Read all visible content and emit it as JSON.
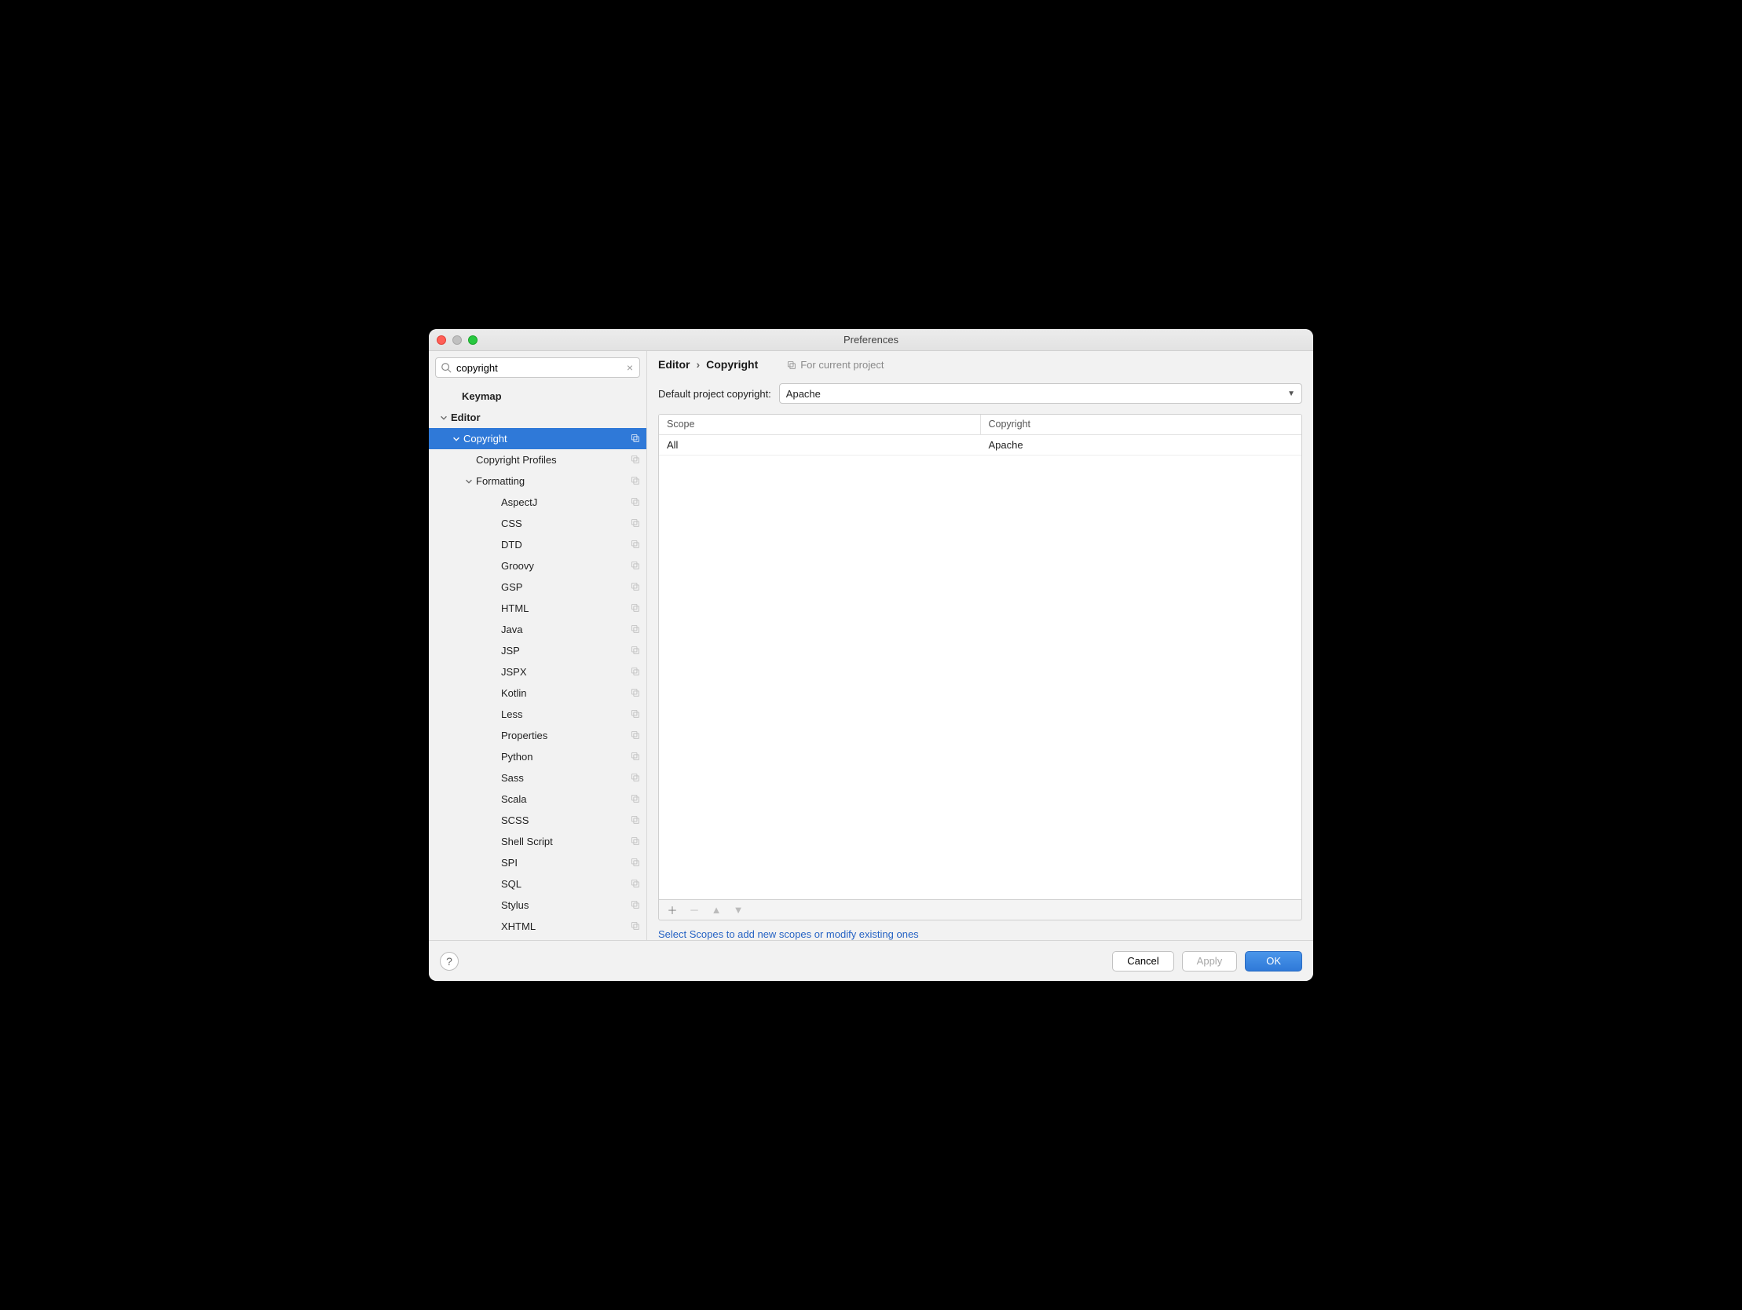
{
  "window": {
    "title": "Preferences"
  },
  "search": {
    "value": "copyright"
  },
  "sidebar": {
    "items": [
      {
        "label": "Keymap",
        "indent": 0,
        "bold": true,
        "arrow": "",
        "badge": false,
        "selected": false
      },
      {
        "label": "Editor",
        "indent": 1,
        "bold": true,
        "arrow": "down",
        "badge": false,
        "selected": false
      },
      {
        "label": "Copyright",
        "indent": 2,
        "bold": false,
        "arrow": "down",
        "badge": true,
        "selected": true
      },
      {
        "label": "Copyright Profiles",
        "indent": 3,
        "bold": false,
        "arrow": "",
        "badge": true,
        "selected": false
      },
      {
        "label": "Formatting",
        "indent": 3,
        "bold": false,
        "arrow": "down",
        "badge": true,
        "selected": false
      },
      {
        "label": "AspectJ",
        "indent": 4,
        "bold": false,
        "arrow": "",
        "badge": true,
        "selected": false
      },
      {
        "label": "CSS",
        "indent": 4,
        "bold": false,
        "arrow": "",
        "badge": true,
        "selected": false
      },
      {
        "label": "DTD",
        "indent": 4,
        "bold": false,
        "arrow": "",
        "badge": true,
        "selected": false
      },
      {
        "label": "Groovy",
        "indent": 4,
        "bold": false,
        "arrow": "",
        "badge": true,
        "selected": false
      },
      {
        "label": "GSP",
        "indent": 4,
        "bold": false,
        "arrow": "",
        "badge": true,
        "selected": false
      },
      {
        "label": "HTML",
        "indent": 4,
        "bold": false,
        "arrow": "",
        "badge": true,
        "selected": false
      },
      {
        "label": "Java",
        "indent": 4,
        "bold": false,
        "arrow": "",
        "badge": true,
        "selected": false
      },
      {
        "label": "JSP",
        "indent": 4,
        "bold": false,
        "arrow": "",
        "badge": true,
        "selected": false
      },
      {
        "label": "JSPX",
        "indent": 4,
        "bold": false,
        "arrow": "",
        "badge": true,
        "selected": false
      },
      {
        "label": "Kotlin",
        "indent": 4,
        "bold": false,
        "arrow": "",
        "badge": true,
        "selected": false
      },
      {
        "label": "Less",
        "indent": 4,
        "bold": false,
        "arrow": "",
        "badge": true,
        "selected": false
      },
      {
        "label": "Properties",
        "indent": 4,
        "bold": false,
        "arrow": "",
        "badge": true,
        "selected": false
      },
      {
        "label": "Python",
        "indent": 4,
        "bold": false,
        "arrow": "",
        "badge": true,
        "selected": false
      },
      {
        "label": "Sass",
        "indent": 4,
        "bold": false,
        "arrow": "",
        "badge": true,
        "selected": false
      },
      {
        "label": "Scala",
        "indent": 4,
        "bold": false,
        "arrow": "",
        "badge": true,
        "selected": false
      },
      {
        "label": "SCSS",
        "indent": 4,
        "bold": false,
        "arrow": "",
        "badge": true,
        "selected": false
      },
      {
        "label": "Shell Script",
        "indent": 4,
        "bold": false,
        "arrow": "",
        "badge": true,
        "selected": false
      },
      {
        "label": "SPI",
        "indent": 4,
        "bold": false,
        "arrow": "",
        "badge": true,
        "selected": false
      },
      {
        "label": "SQL",
        "indent": 4,
        "bold": false,
        "arrow": "",
        "badge": true,
        "selected": false
      },
      {
        "label": "Stylus",
        "indent": 4,
        "bold": false,
        "arrow": "",
        "badge": true,
        "selected": false
      },
      {
        "label": "XHTML",
        "indent": 4,
        "bold": false,
        "arrow": "",
        "badge": true,
        "selected": false
      }
    ]
  },
  "breadcrumb": {
    "root": "Editor",
    "leaf": "Copyright",
    "hint": "For current project"
  },
  "form": {
    "default_label": "Default project copyright:",
    "default_value": "Apache"
  },
  "table": {
    "headers": {
      "scope": "Scope",
      "copyright": "Copyright"
    },
    "rows": [
      {
        "scope": "All",
        "copyright": "Apache"
      }
    ]
  },
  "link": {
    "text": "Select Scopes to add new scopes or modify existing ones"
  },
  "footer": {
    "cancel": "Cancel",
    "apply": "Apply",
    "ok": "OK"
  }
}
